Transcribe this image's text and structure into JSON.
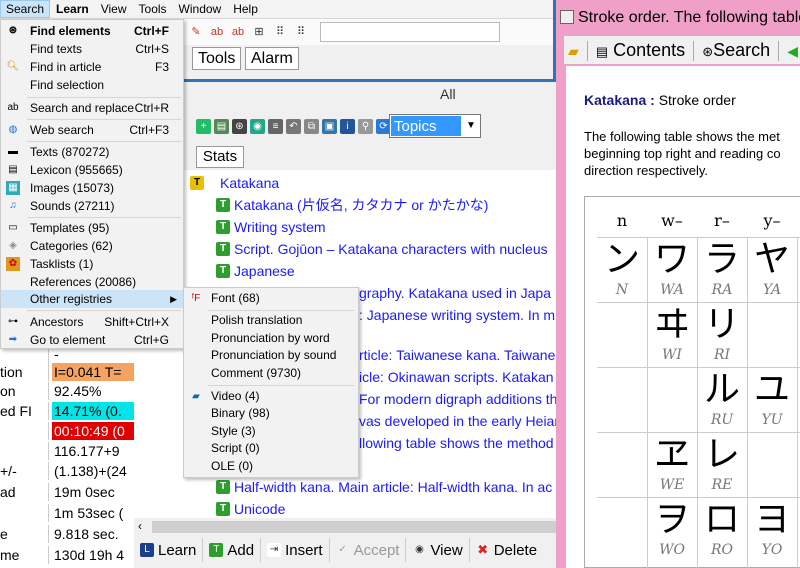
{
  "menubar": {
    "items": [
      "Search",
      "Learn",
      "View",
      "Tools",
      "Window",
      "Help"
    ],
    "active_index": 0
  },
  "search_menu": {
    "items": [
      {
        "label": "Find elements",
        "shortcut": "Ctrl+F",
        "icon": "binoculars-icon",
        "bold": true
      },
      {
        "label": "Find texts",
        "shortcut": "Ctrl+S",
        "icon": ""
      },
      {
        "label": "Find in article",
        "shortcut": "F3",
        "icon": "magnifier-icon"
      },
      {
        "label": "Find selection",
        "shortcut": "",
        "icon": ""
      },
      {
        "label": "Search and replace",
        "shortcut": "Ctrl+R",
        "icon": "replace-icon"
      },
      {
        "label": "Web search",
        "shortcut": "Ctrl+F3",
        "icon": "globe-icon"
      },
      {
        "label": "Texts (870272)",
        "shortcut": "",
        "icon": "texts-icon"
      },
      {
        "label": "Lexicon (955665)",
        "shortcut": "",
        "icon": "lexicon-icon"
      },
      {
        "label": "Images (15073)",
        "shortcut": "",
        "icon": "images-icon"
      },
      {
        "label": "Sounds (27211)",
        "shortcut": "",
        "icon": "sounds-icon"
      },
      {
        "label": "Templates (95)",
        "shortcut": "",
        "icon": "templates-icon"
      },
      {
        "label": "Categories (62)",
        "shortcut": "",
        "icon": "categories-icon"
      },
      {
        "label": "Tasklists (1)",
        "shortcut": "",
        "icon": "tasklists-icon"
      },
      {
        "label": "References (20086)",
        "shortcut": "",
        "icon": ""
      },
      {
        "label": "Other registries",
        "shortcut": "",
        "icon": ""
      },
      {
        "label": "Ancestors",
        "shortcut": "Shift+Ctrl+X",
        "icon": "ancestors-icon"
      },
      {
        "label": "Go to element",
        "shortcut": "Ctrl+G",
        "icon": "arrow-right-icon"
      }
    ]
  },
  "submenu": {
    "items": [
      "Font (68)",
      "Polish translation",
      "Pronunciation by word",
      "Pronunciation by sound",
      "Comment (9730)",
      "Video (4)",
      "Binary (98)",
      "Style (3)",
      "Script (0)",
      "OLE (0)"
    ]
  },
  "tabs": [
    "Tools",
    "Alarm"
  ],
  "all_label": "All",
  "topics_select": "Topics",
  "stats_tab": "Stats",
  "tree": {
    "rows": [
      "Katakana",
      "Katakana (片仮名, カタカナ or かたかな)",
      "Writing system",
      "Script. Gojūon – Katakana characters with nucleus",
      "Japanese",
      "graphy. Katakana used in Japa",
      ": Japanese writing system. In m",
      "rticle: Taiwanese kana. Taiwane",
      "icle: Okinawan scripts. Katakan",
      "For modern digraph additions th",
      "vas developed in the early Heian",
      "llowing table shows the method",
      "Half-width kana. Main article: Half-width kana. In ac",
      "Unicode"
    ]
  },
  "bottom_buttons": [
    "Learn",
    "Add",
    "Insert",
    "Accept",
    "View",
    "Delete"
  ],
  "left_panel": {
    "rows": [
      {
        "k": "",
        "v": "-"
      },
      {
        "k": "tion",
        "v": "I=0.041 T=",
        "bg": "#f4a460"
      },
      {
        "k": "on",
        "v": "92.45%"
      },
      {
        "k": "ed FI",
        "v": "14.71% (0.",
        "bg": "#00e5e5"
      },
      {
        "k": "",
        "v": "00:10:49 (0",
        "bg": "#e00000",
        "fg": "#ffffff"
      },
      {
        "k": "",
        "v": "116.177+9"
      },
      {
        "k": "+/-",
        "v": "(1.138)+(24"
      },
      {
        "k": "ad",
        "v": "19m 0sec"
      },
      {
        "k": "",
        "v": "1m 53sec ("
      },
      {
        "k": "e",
        "v": "9.818 sec."
      },
      {
        "k": "me",
        "v": "130d 19h 4"
      }
    ]
  },
  "right_window": {
    "title": "Stroke order. The following table",
    "toolbar": [
      "Contents",
      "Search"
    ],
    "heading_bold": "Katakana :",
    "heading_rest": " Stroke order",
    "para": [
      "The following table shows the met",
      "beginning top right and reading co",
      "direction respectively."
    ],
    "columns": [
      "n",
      "w–",
      "r–",
      "y–"
    ],
    "kana": [
      {
        "k": "ン",
        "r": "N"
      },
      {
        "k": "ワ",
        "r": "WA"
      },
      {
        "k": "ラ",
        "r": "RA"
      },
      {
        "k": "ヤ",
        "r": "YA"
      },
      {
        "k": "",
        "r": ""
      },
      {
        "k": "ヰ",
        "r": "WI"
      },
      {
        "k": "リ",
        "r": "RI"
      },
      {
        "k": "",
        "r": ""
      },
      {
        "k": "",
        "r": ""
      },
      {
        "k": "",
        "r": ""
      },
      {
        "k": "ル",
        "r": "RU"
      },
      {
        "k": "ユ",
        "r": "YU"
      },
      {
        "k": "",
        "r": ""
      },
      {
        "k": "ヱ",
        "r": "WE"
      },
      {
        "k": "レ",
        "r": "RE"
      },
      {
        "k": "",
        "r": ""
      },
      {
        "k": "",
        "r": ""
      },
      {
        "k": "ヲ",
        "r": "WO"
      },
      {
        "k": "ロ",
        "r": "RO"
      },
      {
        "k": "ヨ",
        "r": "YO"
      }
    ]
  },
  "colors": {
    "accent": "#2e75b6",
    "tree_link": "#1a1aff",
    "menu_highlight": "#cce4f7",
    "right_frame": "#f0a0c8"
  }
}
